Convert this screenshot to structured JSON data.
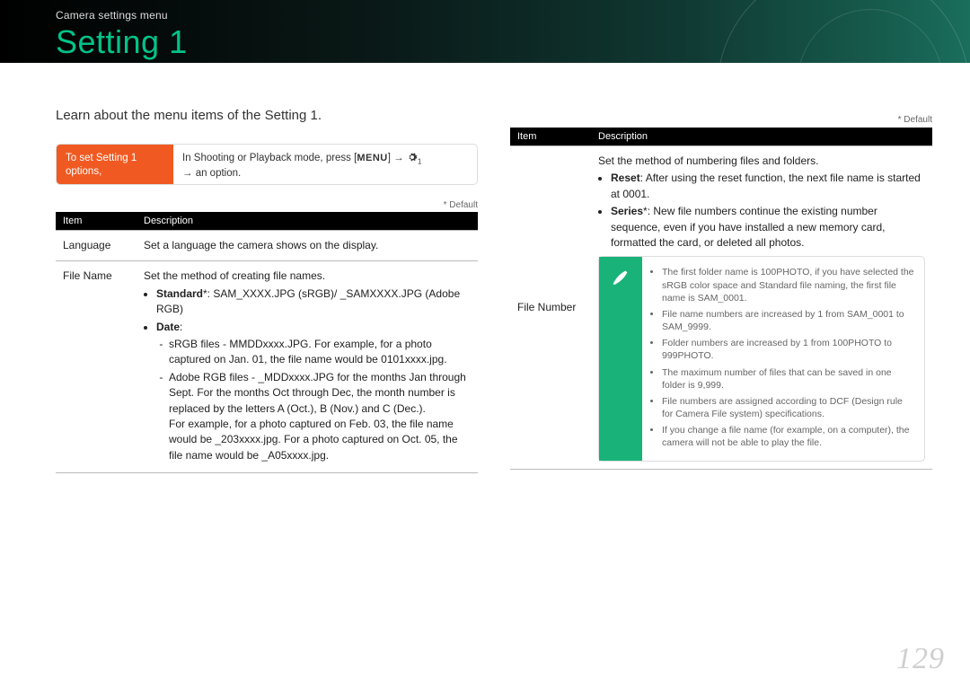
{
  "banner": {
    "section": "Camera settings menu",
    "title": "Setting 1"
  },
  "intro": "Learn about the menu items of the Setting 1.",
  "howbox": {
    "left_l1": "To set Setting 1",
    "left_l2": "options,",
    "right_pre": "In Shooting or Playback mode, press [",
    "right_menu": "MENU",
    "right_mid": "] → ",
    "right_post": " → an option."
  },
  "default_label": "* Default",
  "table_headers": {
    "item": "Item",
    "desc": "Description"
  },
  "left_table": {
    "row1": {
      "item": "Language",
      "desc": "Set a language the camera shows on the display."
    },
    "row2": {
      "item": "File Name",
      "d_intro": "Set the method of creating file names.",
      "d_standard_label": "Standard",
      "d_standard_rest": "*: SAM_XXXX.JPG (sRGB)/ _SAMXXXX.JPG (Adobe RGB)",
      "d_date_label": "Date",
      "d_date_colon": ":",
      "d_s1": "sRGB files - MMDDxxxx.JPG. For example, for a photo captured on Jan. 01, the file name would be 0101xxxx.jpg.",
      "d_s2a": "Adobe RGB files - _MDDxxxx.JPG for the months Jan through Sept. For the months Oct through Dec, the month number is replaced by the letters A (Oct.), B (Nov.) and C (Dec.).",
      "d_s2b": "For example, for a photo captured on Feb. 03, the file name would be _203xxxx.jpg. For a photo captured on Oct. 05, the file name would be _A05xxxx.jpg."
    }
  },
  "right_table": {
    "row1": {
      "item": "File Number",
      "d_intro": "Set the method of numbering files and folders.",
      "d_reset_label": "Reset",
      "d_reset_rest": ": After using the reset function, the next file name is started at 0001.",
      "d_series_label": "Series",
      "d_series_rest": "*: New file numbers continue the existing number sequence, even if you have installed a new memory card, formatted the card, or deleted all photos.",
      "note_items": [
        "The first folder name is 100PHOTO, if you have selected the sRGB color space and Standard file naming, the first file name is SAM_0001.",
        "File name numbers are increased by 1 from SAM_0001 to SAM_9999.",
        "Folder numbers are increased by 1 from 100PHOTO to 999PHOTO.",
        "The maximum number of files that can be saved in one folder is 9,999.",
        "File numbers are assigned according to DCF (Design rule for Camera File system) specifications.",
        "If you change a file name (for example, on a computer), the camera will not be able to play the file."
      ]
    }
  },
  "page_number": "129"
}
